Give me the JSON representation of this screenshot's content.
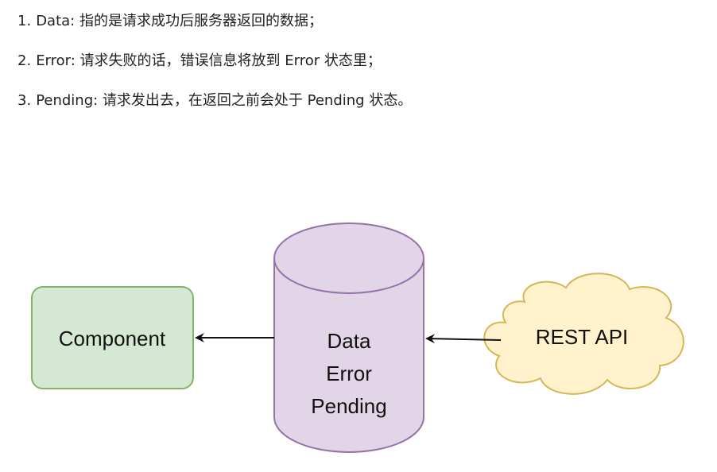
{
  "notes": [
    {
      "num": "1.",
      "text": "Data: 指的是请求成功后服务器返回的数据；"
    },
    {
      "num": "2.",
      "text": "Error: 请求失败的话，错误信息将放到 Error 状态里；"
    },
    {
      "num": "3.",
      "text": "Pending: 请求发出去，在返回之前会处于 Pending 状态。"
    }
  ],
  "diagram": {
    "component_label": "Component",
    "store_lines": [
      "Data",
      "Error",
      "Pending"
    ],
    "api_label": "REST API",
    "colors": {
      "component_fill": "#d5e8d4",
      "component_stroke": "#82b366",
      "store_fill": "#e1d5e7",
      "store_stroke": "#9673a6",
      "api_fill": "#fff2cc",
      "api_stroke": "#d6b656",
      "arrow": "#111111"
    }
  }
}
